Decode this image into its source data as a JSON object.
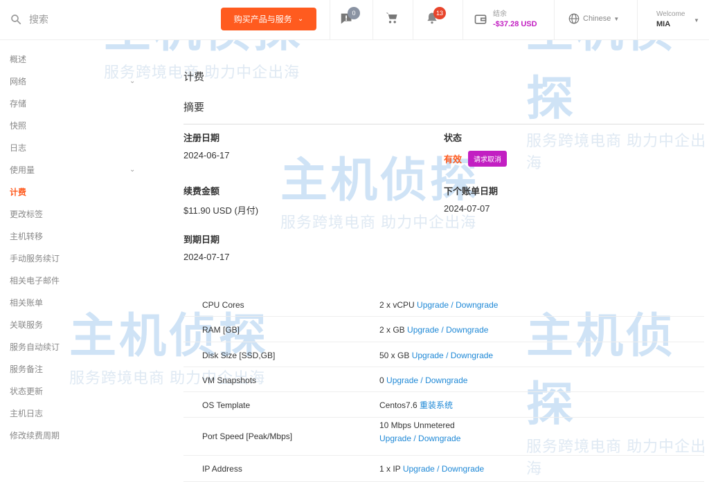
{
  "topbar": {
    "search_placeholder": "搜索",
    "buy_button": "购买产品与服务",
    "messages_badge": "0",
    "notifications_badge": "13",
    "balance_label": "结余",
    "balance_amount": "-$37.28 USD",
    "language": "Chinese",
    "welcome_label": "Welcome",
    "username": "MIA"
  },
  "sidebar": {
    "items": [
      {
        "label": "概述"
      },
      {
        "label": "网络",
        "expandable": true
      },
      {
        "label": "存储"
      },
      {
        "label": "快照"
      },
      {
        "label": "日志"
      },
      {
        "label": "使用量",
        "expandable": true
      },
      {
        "label": "计费",
        "active": true
      },
      {
        "label": "更改标签"
      },
      {
        "label": "主机转移"
      },
      {
        "label": "手动服务续订"
      },
      {
        "label": "相关电子邮件"
      },
      {
        "label": "相关账单"
      },
      {
        "label": "关联服务"
      },
      {
        "label": "服务自动续订"
      },
      {
        "label": "服务备注"
      },
      {
        "label": "状态更新"
      },
      {
        "label": "主机日志"
      },
      {
        "label": "修改续费周期"
      }
    ]
  },
  "billing": {
    "title": "计费",
    "summary_title": "摘要",
    "reg_date_label": "注册日期",
    "reg_date": "2024-06-17",
    "status_label": "状态",
    "status": "有效",
    "cancel_button": "请求取消",
    "renew_amount_label": "续费金额",
    "renew_amount": "$11.90 USD (月付)",
    "next_invoice_label": "下个账单日期",
    "next_invoice": "2024-07-07",
    "expiry_label": "到期日期",
    "expiry": "2024-07-17"
  },
  "specs": [
    {
      "key": "CPU Cores",
      "value": "2 x vCPU",
      "link": "Upgrade / Downgrade"
    },
    {
      "key": "RAM [GB]",
      "value": "2 x GB",
      "link": "Upgrade / Downgrade"
    },
    {
      "key": "Disk Size [SSD,GB]",
      "value": "50 x GB",
      "link": "Upgrade / Downgrade"
    },
    {
      "key": "VM Snapshots",
      "value": "0",
      "link": "Upgrade / Downgrade"
    },
    {
      "key": "OS Template",
      "value": "Centos7.6",
      "link": "重装系统"
    },
    {
      "key": "Port Speed [Peak/Mbps]",
      "value": "10 Mbps Unmetered",
      "link": "Upgrade / Downgrade"
    },
    {
      "key": "IP Address",
      "value": "1 x IP",
      "link": "Upgrade / Downgrade"
    }
  ],
  "watermark": {
    "logo_text": "主机侦探",
    "slogan": "服务跨境电商 助力中企出海"
  },
  "colors": {
    "accent": "#ff5b1f",
    "cancel": "#c21fc2",
    "link": "#1e88d6",
    "balance": "#c21fc2"
  }
}
